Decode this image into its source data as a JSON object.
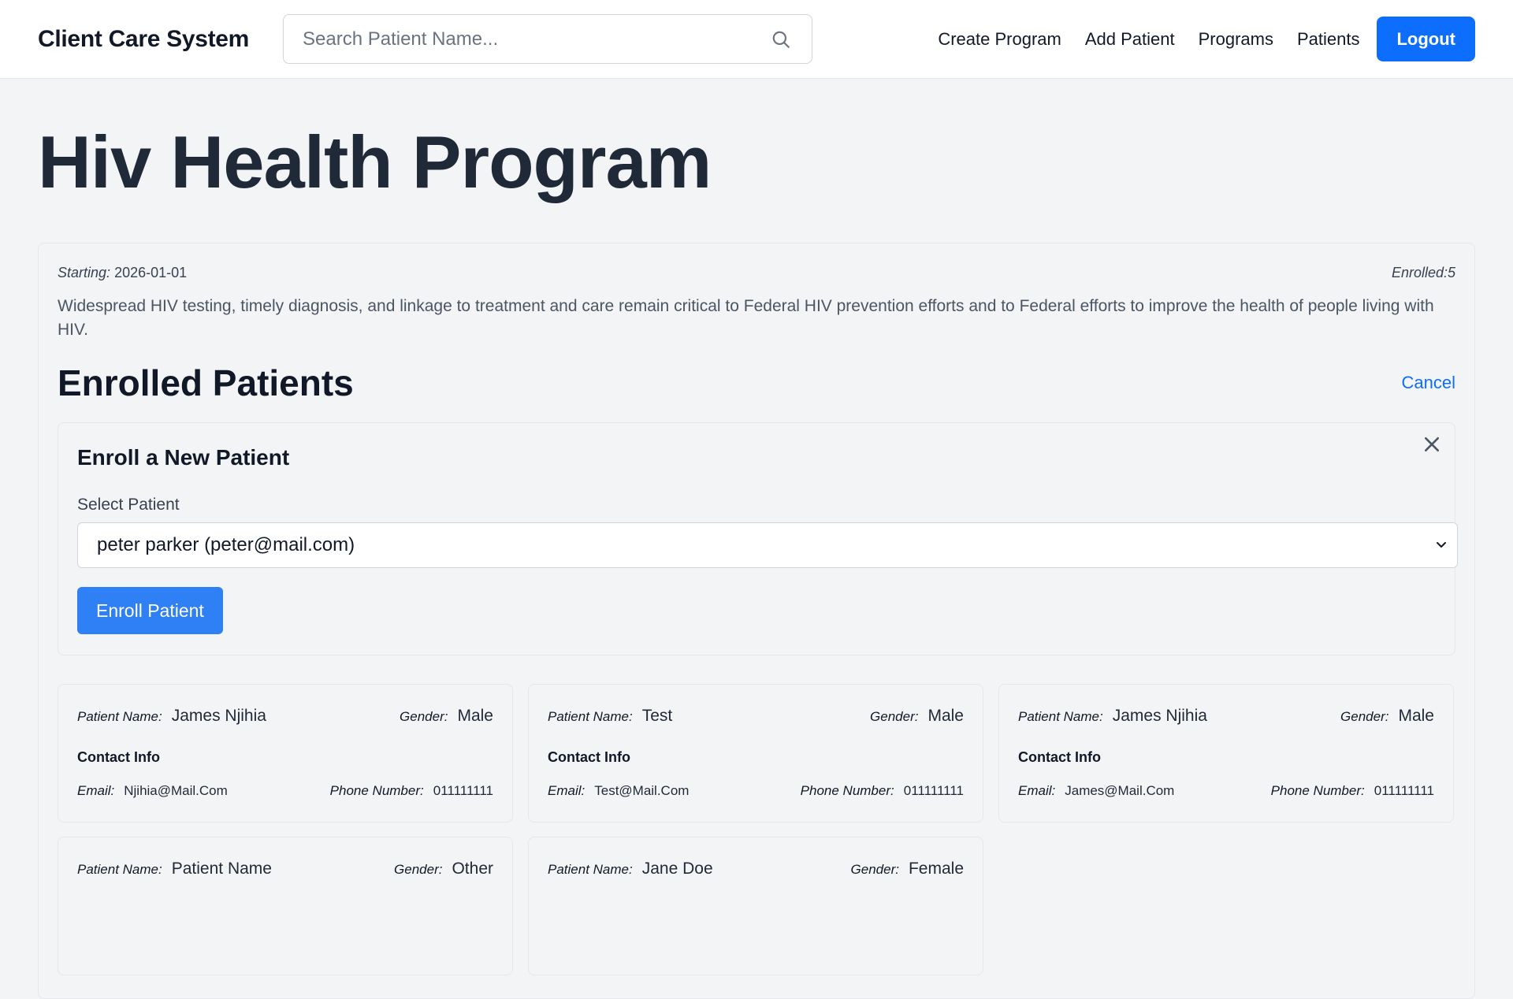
{
  "navbar": {
    "brand": "Client Care System",
    "search_placeholder": "Search Patient Name...",
    "links": [
      "Create Program",
      "Add Patient",
      "Programs",
      "Patients"
    ],
    "logout_label": "Logout"
  },
  "program": {
    "title": "Hiv Health Program",
    "starting_label": "Starting:",
    "starting_date": "2026-01-01",
    "enrolled_label": "Enrolled:5",
    "description": "Widespread HIV testing, timely diagnosis, and linkage to treatment and care remain critical to Federal HIV prevention efforts and to Federal efforts to improve the health of people living with HIV."
  },
  "enrolled": {
    "title": "Enrolled Patients",
    "cancel_label": "Cancel"
  },
  "enroll_form": {
    "title": "Enroll a New Patient",
    "select_label": "Select Patient",
    "selected_value": "peter parker (peter@mail.com)",
    "submit_label": "Enroll Patient"
  },
  "labels": {
    "patient_name": "Patient Name:",
    "gender": "Gender:",
    "contact_info": "Contact Info",
    "email": "Email:",
    "phone": "Phone Number:"
  },
  "patients": [
    {
      "name": "James Njihia",
      "gender": "Male",
      "email": "Njihia@Mail.Com",
      "phone": "011111111"
    },
    {
      "name": "Test",
      "gender": "Male",
      "email": "Test@Mail.Com",
      "phone": "011111111"
    },
    {
      "name": "James Njihia",
      "gender": "Male",
      "email": "James@Mail.Com",
      "phone": "011111111"
    },
    {
      "name": "Patient Name",
      "gender": "Other"
    },
    {
      "name": "Jane Doe",
      "gender": "Female"
    }
  ]
}
